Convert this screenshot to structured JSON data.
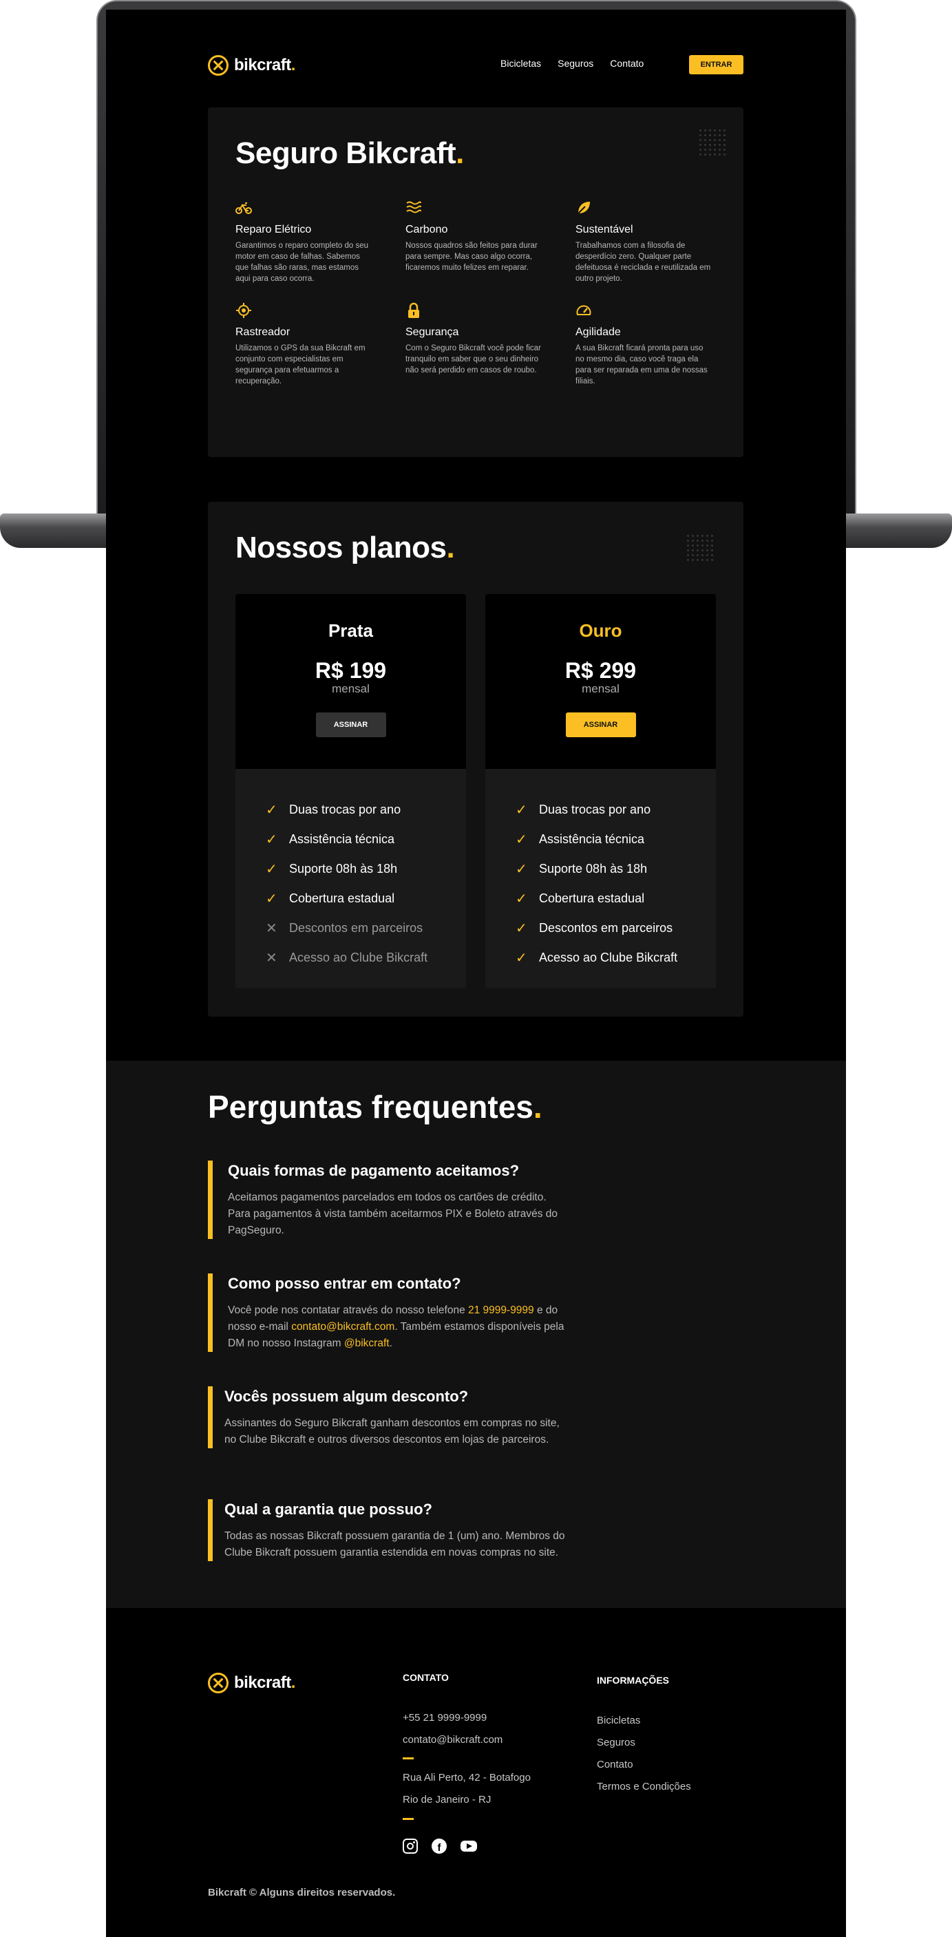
{
  "brand": {
    "name": "bikcraft",
    "dot": ".",
    "accent": "#fbbf24"
  },
  "nav": {
    "items": [
      "Bicicletas",
      "Seguros",
      "Contato"
    ],
    "cta": "ENTRAR"
  },
  "seguro": {
    "title": "Seguro Bikcraft",
    "features": [
      {
        "icon": "bike-icon",
        "title": "Reparo Elétrico",
        "desc": "Garantimos o reparo completo do seu motor em caso de falhas. Sabemos que falhas são raras, mas estamos aqui para caso ocorra."
      },
      {
        "icon": "waves-icon",
        "title": "Carbono",
        "desc": "Nossos quadros são feitos para durar para sempre. Mas caso algo ocorra, ficaremos muito felizes em reparar."
      },
      {
        "icon": "leaf-icon",
        "title": "Sustentável",
        "desc": "Trabalhamos com a filosofia de desperdício zero. Qualquer parte defeituosa é reciclada e reutilizada em outro projeto."
      },
      {
        "icon": "target-icon",
        "title": "Rastreador",
        "desc": "Utilizamos o GPS da sua Bikcraft em conjunto com especialistas em segurança para efetuarmos a recuperação."
      },
      {
        "icon": "lock-icon",
        "title": "Segurança",
        "desc": "Com o Seguro Bikcraft você pode ficar tranquilo em saber que o seu dinheiro não será perdido em casos de roubo."
      },
      {
        "icon": "gauge-icon",
        "title": "Agilidade",
        "desc": "A sua Bikcraft ficará pronta para uso no mesmo dia, caso você traga ela para ser reparada em uma de nossas filiais."
      }
    ]
  },
  "planos": {
    "title": "Nossos planos",
    "plans": [
      {
        "name": "Prata",
        "price": "R$ 199",
        "period": "mensal",
        "button": "ASSINAR",
        "items": [
          {
            "text": "Duas trocas por ano",
            "included": true
          },
          {
            "text": "Assistência técnica",
            "included": true
          },
          {
            "text": "Suporte 08h às 18h",
            "included": true
          },
          {
            "text": "Cobertura estadual",
            "included": true
          },
          {
            "text": "Descontos em parceiros",
            "included": false
          },
          {
            "text": "Acesso ao Clube Bikcraft",
            "included": false
          }
        ]
      },
      {
        "name": "Ouro",
        "price": "R$ 299",
        "period": "mensal",
        "button": "ASSINAR",
        "items": [
          {
            "text": "Duas trocas por ano",
            "included": true
          },
          {
            "text": "Assistência técnica",
            "included": true
          },
          {
            "text": "Suporte 08h às 18h",
            "included": true
          },
          {
            "text": "Cobertura estadual",
            "included": true
          },
          {
            "text": "Descontos em parceiros",
            "included": true
          },
          {
            "text": "Acesso ao Clube Bikcraft",
            "included": true
          }
        ]
      }
    ]
  },
  "faq": {
    "title": "Perguntas frequentes",
    "items": [
      {
        "q": "Quais formas de pagamento aceitamos?",
        "a": "Aceitamos pagamentos parcelados em todos os cartões de crédito. Para pagamentos à vista também aceitarmos PIX e Boleto através do PagSeguro."
      },
      {
        "q": "Como posso entrar em contato?",
        "a_pre": "Você pode nos contatar através do nosso telefone ",
        "phone": "21 9999-9999",
        "a_mid": " e do nosso e-mail ",
        "email": "contato@bikcraft.com",
        "a_mid2": ". Também estamos disponíveis pela DM no nosso Instagram ",
        "insta": "@bikcraft",
        "a_end": "."
      },
      {
        "q": "Vocês possuem algum desconto?",
        "a": "Assinantes do Seguro Bikcraft ganham descontos em compras no site, no Clube Bikcraft e outros diversos descontos em lojas de parceiros."
      },
      {
        "q": "Qual a garantia que possuo?",
        "a": "Todas as nossas Bikcraft possuem garantia de 1 (um) ano. Membros do Clube Bikcraft possuem garantia estendida em novas compras no site."
      }
    ]
  },
  "footer": {
    "contato_title": "CONTATO",
    "phone": "+55 21 9999-9999",
    "email": "contato@bikcraft.com",
    "address1": "Rua Ali Perto, 42 - Botafogo",
    "address2": "Rio de Janeiro - RJ",
    "info_title": "INFORMAÇÕES",
    "info_links": [
      "Bicicletas",
      "Seguros",
      "Contato",
      "Termos e Condições"
    ],
    "social": [
      "instagram-icon",
      "facebook-icon",
      "youtube-icon"
    ],
    "copyright": "Bikcraft © Alguns direitos reservados."
  }
}
